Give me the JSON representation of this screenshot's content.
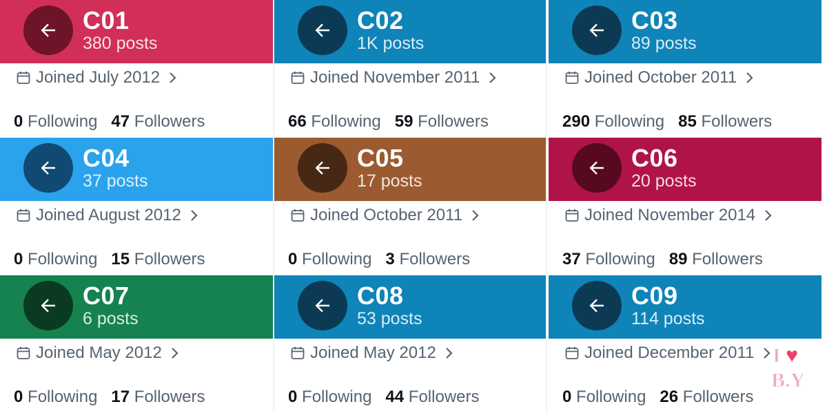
{
  "profiles": [
    {
      "name": "C01",
      "posts": "380 posts",
      "joined": "Joined July 2012",
      "following_count": "0",
      "following_label": "Following",
      "followers_count": "47",
      "followers_label": "Followers",
      "banner_color": "#d12f57",
      "button_color": "#6e1428"
    },
    {
      "name": "C02",
      "posts": "1K posts",
      "joined": "Joined November 2011",
      "following_count": "66",
      "following_label": "Following",
      "followers_count": "59",
      "followers_label": "Followers",
      "banner_color": "#0e84b8",
      "button_color": "#0c3a54"
    },
    {
      "name": "C03",
      "posts": "89 posts",
      "joined": "Joined October 2011",
      "following_count": "290",
      "following_label": "Following",
      "followers_count": "85",
      "followers_label": "Followers",
      "banner_color": "#0e84b8",
      "button_color": "#0c3a54"
    },
    {
      "name": "C04",
      "posts": "37 posts",
      "joined": "Joined August 2012",
      "following_count": "0",
      "following_label": "Following",
      "followers_count": "15",
      "followers_label": "Followers",
      "banner_color": "#2aa3ec",
      "button_color": "#104a72"
    },
    {
      "name": "C05",
      "posts": "17 posts",
      "joined": "Joined October 2011",
      "following_count": "0",
      "following_label": "Following",
      "followers_count": "3",
      "followers_label": "Followers",
      "banner_color": "#9b5a30",
      "button_color": "#472814"
    },
    {
      "name": "C06",
      "posts": "20 posts",
      "joined": "Joined November 2014",
      "following_count": "37",
      "following_label": "Following",
      "followers_count": "89",
      "followers_label": "Followers",
      "banner_color": "#b0134a",
      "button_color": "#56091f"
    },
    {
      "name": "C07",
      "posts": "6 posts",
      "joined": "Joined May 2012",
      "following_count": "0",
      "following_label": "Following",
      "followers_count": "17",
      "followers_label": "Followers",
      "banner_color": "#15824f",
      "button_color": "#0b3a22"
    },
    {
      "name": "C08",
      "posts": "53 posts",
      "joined": "Joined May 2012",
      "following_count": "0",
      "following_label": "Following",
      "followers_count": "44",
      "followers_label": "Followers",
      "banner_color": "#0e84b8",
      "button_color": "#0c3a54"
    },
    {
      "name": "C09",
      "posts": "114 posts",
      "joined": "Joined December 2011",
      "following_count": "0",
      "following_label": "Following",
      "followers_count": "26",
      "followers_label": "Followers",
      "banner_color": "#0e84b8",
      "button_color": "#0c3a54"
    }
  ],
  "icons": {
    "back": "arrow-left-icon",
    "calendar": "calendar-icon",
    "chevron": "chevron-right-icon"
  },
  "watermark": {
    "line1": "I ♥",
    "line2": "B.Y",
    "color": "#f2a6c8",
    "heart_color": "#ee3f6e"
  }
}
